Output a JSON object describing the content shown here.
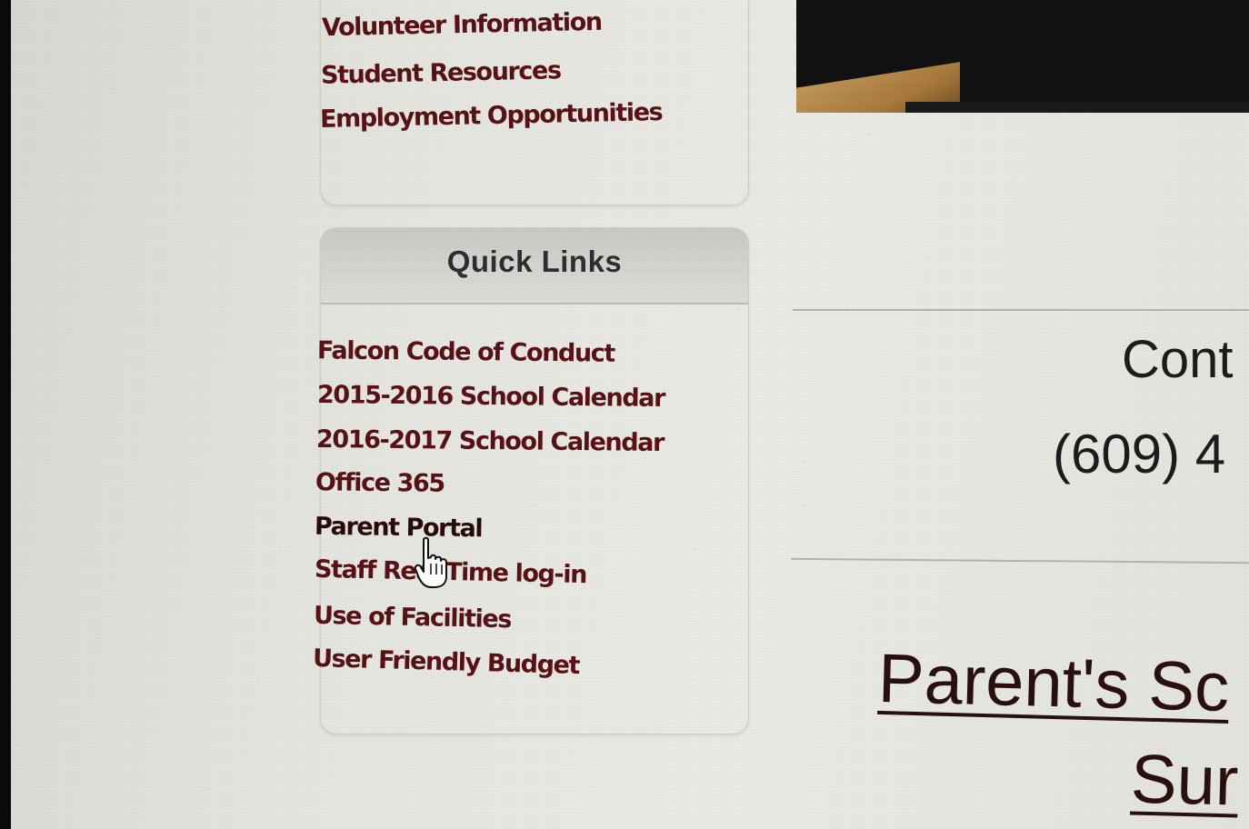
{
  "nav": {
    "items": [
      {
        "label": "Volunteer Information"
      },
      {
        "label": "Student Resources"
      },
      {
        "label": "Employment Opportunities"
      }
    ]
  },
  "quick_links": {
    "title": "Quick Links",
    "items": [
      {
        "label": "Falcon Code of Conduct"
      },
      {
        "label": "2015-2016 School Calendar"
      },
      {
        "label": "2016-2017 School Calendar"
      },
      {
        "label": "Office 365"
      },
      {
        "label": "Parent Portal"
      },
      {
        "label": "Staff Real Time log-in"
      },
      {
        "label": "Use of Facilities"
      },
      {
        "label": "User Friendly Budget"
      }
    ]
  },
  "contact": {
    "heading": "Cont",
    "phone": "(609) 4"
  },
  "survey": {
    "line1": "Parent's Sc",
    "line2": "Sur"
  },
  "colors": {
    "link": "#5a1114",
    "heading": "#2f2f2f",
    "header_bg": "#d6d6d2"
  },
  "icons": {
    "cursor": "hand-pointer-icon"
  }
}
